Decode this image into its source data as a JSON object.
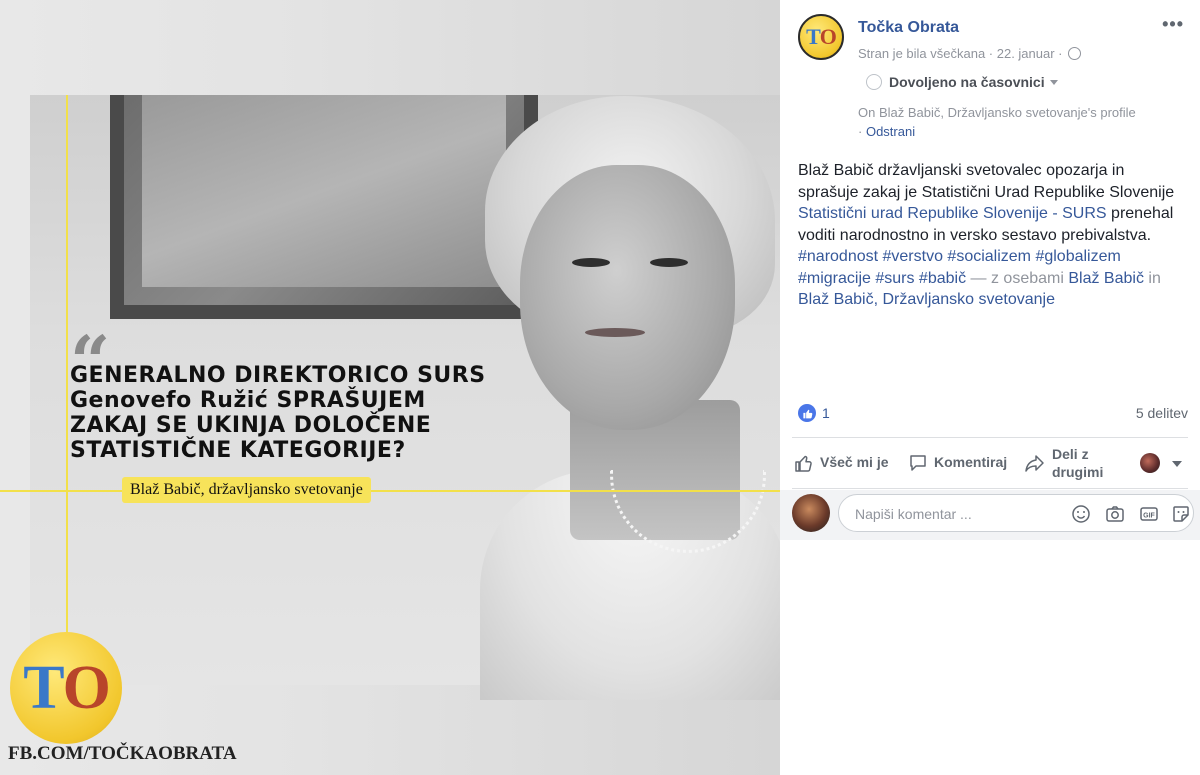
{
  "image": {
    "headline_lines": [
      "GENERALNO DIREKTORICO SURS",
      "Genovefo Ružić SPRAŠUJEM",
      "ZAKAJ SE UKINJA DOLOČENE",
      "STATISTIČNE KATEGORIJE?"
    ],
    "quote_mark": "“",
    "byline": "Blaž Babič, državljansko svetovanje",
    "logo_t": "T",
    "logo_o": "O",
    "fb_url": "FB.COM/TOČKAOBRATA"
  },
  "post": {
    "page_name": "Točka Obrata",
    "avatar_t": "T",
    "avatar_o": "O",
    "meta": "Stran je bila všečkana · 22. januar ·",
    "timeline_label": "Dovoljeno na časovnici",
    "profile_text": "On Blaž Babič, Državljansko svetovanje's profile",
    "profile_remove_prefix": "·",
    "profile_remove": "Odstrani",
    "more_label": "•••",
    "text_plain_1": "Blaž Babič državljanski svetovalec opozarja in sprašuje zakaj je Statistični Urad Republike Slovenije",
    "text_link_surs": "Statistični urad Republike Slovenije - SURS",
    "text_plain_2": "prenehal voditi narodnostno in versko sestavo prebivalstva.",
    "hashtags": "#narodnost #verstvo #socializem #globalizem #migracije #surs #babič",
    "with_text": "— z osebami",
    "person_1": "Blaž Babič",
    "and_text": "in",
    "person_2": "Blaž Babič, Državljansko svetovanje"
  },
  "reactions": {
    "like_count": "1",
    "shares": "5 delitev"
  },
  "actions": {
    "like": "Všeč mi je",
    "comment": "Komentiraj",
    "share_line1": "Deli z",
    "share_line2": "drugimi"
  },
  "comment": {
    "placeholder": "Napiši komentar ..."
  },
  "colors": {
    "link": "#365899",
    "muted": "#90949c",
    "accent_yellow": "#f2e04a",
    "like_blue": "#4a76e8"
  }
}
